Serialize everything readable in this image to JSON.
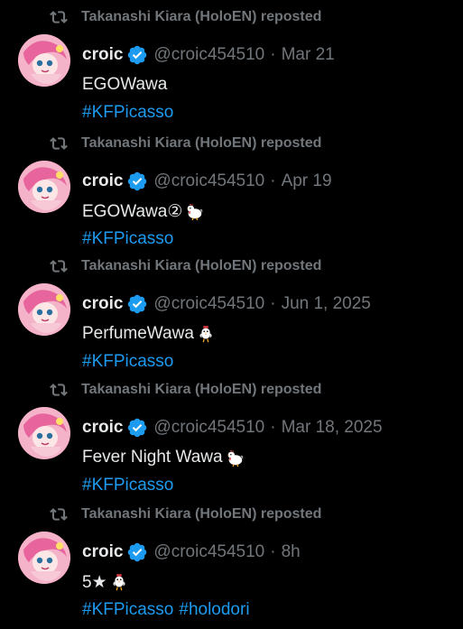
{
  "feed": {
    "posts": [
      {
        "repost_label": "Takanashi Kiara (HoloEN) reposted",
        "name": "croic",
        "handle": "@croic454510",
        "separator": "·",
        "time": "Mar 21",
        "text": "EGOWawa",
        "text_emoji": "",
        "hashtags": [
          "#KFPicasso"
        ]
      },
      {
        "repost_label": "Takanashi Kiara (HoloEN) reposted",
        "name": "croic",
        "handle": "@croic454510",
        "separator": "·",
        "time": "Apr 19",
        "text": "EGOWawa②",
        "text_emoji": "rooster-emoji",
        "hashtags": [
          "#KFPicasso"
        ]
      },
      {
        "repost_label": "Takanashi Kiara (HoloEN) reposted",
        "name": "croic",
        "handle": "@croic454510",
        "separator": "·",
        "time": "Jun 1, 2025",
        "text": "PerfumeWawa",
        "text_emoji": "chicken-emoji",
        "hashtags": [
          "#KFPicasso"
        ]
      },
      {
        "repost_label": "Takanashi Kiara (HoloEN) reposted",
        "name": "croic",
        "handle": "@croic454510",
        "separator": "·",
        "time": "Mar 18, 2025",
        "text": "Fever Night Wawa",
        "text_emoji": "rooster-emoji",
        "hashtags": [
          "#KFPicasso"
        ]
      },
      {
        "repost_label": "Takanashi Kiara (HoloEN) reposted",
        "name": "croic",
        "handle": "@croic454510",
        "separator": "·",
        "time": "8h",
        "text": "5★",
        "text_emoji": "chicken-emoji",
        "hashtags": [
          "#KFPicasso",
          "#holodori"
        ]
      }
    ]
  },
  "colors": {
    "background": "#000000",
    "primary_text": "#e7e9ea",
    "secondary_text": "#71767b",
    "link": "#1d9bf0",
    "verified": "#1d9bf0"
  },
  "icons": {
    "repost": "repost-icon",
    "verified": "verified-badge-icon"
  }
}
